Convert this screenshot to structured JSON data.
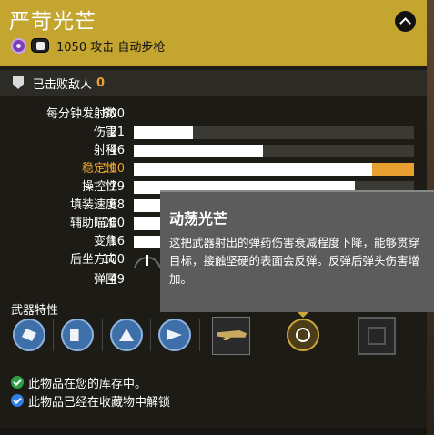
{
  "item": {
    "name": "严苛光芒",
    "subtitle": "1050 攻击 自动步枪",
    "power": 1050,
    "element_icon": "void-element-icon",
    "slot_icon": "kinetic-slot-icon",
    "header_color": "#c4a52f"
  },
  "kills": {
    "label": "已击败敌人",
    "value": "0"
  },
  "stats": [
    {
      "label": "每分钟发射数",
      "value": "600",
      "bar": null
    },
    {
      "label": "伤害",
      "value": "21",
      "bar": 0.21
    },
    {
      "label": "射程",
      "value": "46",
      "bar": 0.46
    },
    {
      "label": "稳定性",
      "value": "100",
      "bar": 0.85,
      "bonus": 0.15,
      "highlight": true
    },
    {
      "label": "操控性",
      "value": "79",
      "bar": 0.79
    },
    {
      "label": "填装速度",
      "value": "68",
      "bar": 0.68
    },
    {
      "label": "辅助瞄准",
      "value": "100",
      "bar": 1.0
    },
    {
      "label": "变焦",
      "value": "16",
      "bar": 0.16
    },
    {
      "label": "后坐方向",
      "value": "100",
      "bar": null,
      "type": "recoil"
    },
    {
      "label": "弹匣",
      "value": "49",
      "bar": null
    }
  ],
  "perks": {
    "title": "武器特性",
    "icons": [
      "barrel-perk-icon",
      "magazine-perk-icon",
      "recycle-perk-icon",
      "sight-perk-icon",
      "weapon-ornament-icon",
      "intrinsic-frame-icon",
      "empty-mod-slot-icon"
    ]
  },
  "tooltip": {
    "title": "动荡光芒",
    "description": "这把武器射出的弹药伤害衰减程度下降，能够贯穿目标，接触坚硬的表面会反弹。反弹后弹头伤害增加。"
  },
  "notes": [
    {
      "text": "此物品在您的库存中。",
      "color": "#2ea043",
      "icon": "check-green-icon"
    },
    {
      "text": "此物品已经在收藏物中解锁",
      "color": "#2f7fe6",
      "icon": "check-blue-icon"
    }
  ],
  "colors": {
    "accent": "#e8a030",
    "panel": "#1d1b15",
    "tooltip": "#5c5c5c"
  }
}
